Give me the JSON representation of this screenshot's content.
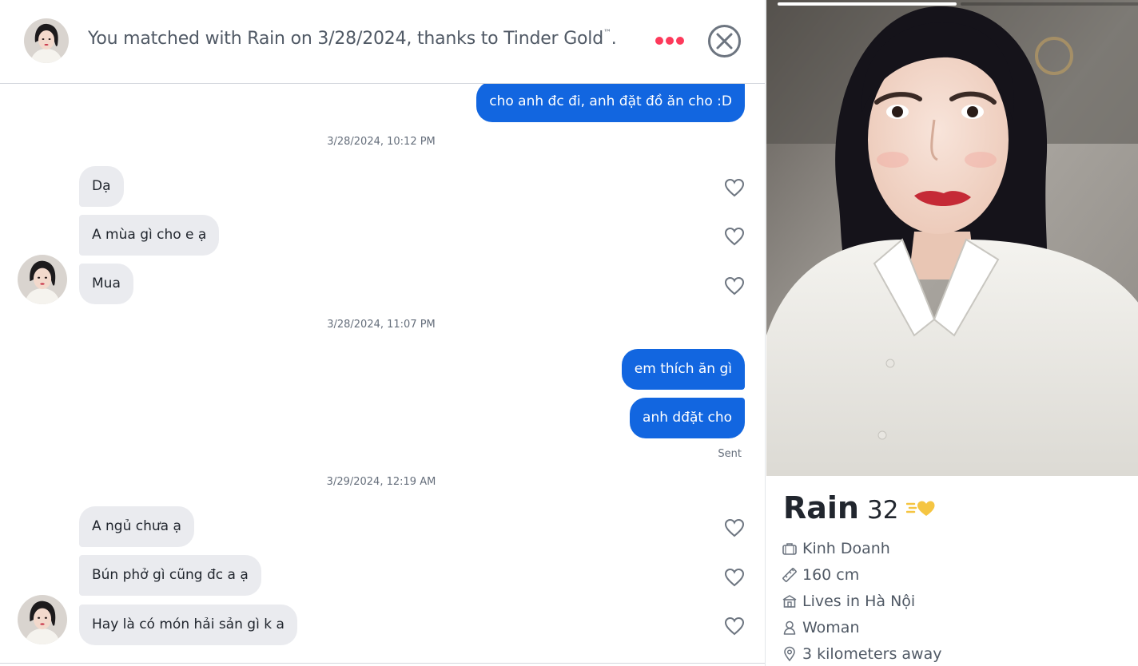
{
  "header": {
    "match_text": "You matched with Rain on 3/28/2024, thanks to Tinder Gold",
    "trademark": "™",
    "period": ".",
    "more_icon": "more-dots-icon",
    "close_icon": "close-circle-icon"
  },
  "messages": {
    "m1": "cho anh đc đi, anh đặt đồ ăn cho :D",
    "ts1": "3/28/2024, 10:12 PM",
    "m2": "Dạ",
    "m3": "A mùa gì cho e ạ",
    "m4": "Mua",
    "ts2": "3/28/2024, 11:07 PM",
    "m5": "em thích ăn gì",
    "m6": "anh dđặt cho",
    "sent_status": "Sent",
    "ts3": "3/29/2024, 12:19 AM",
    "m7": "A ngủ chưa ạ",
    "m8": "Bún phở gì cũng đc a ạ",
    "m9": "Hay là có món hải sản gì k a"
  },
  "profile": {
    "name": "Rain",
    "age": "32",
    "photo_count": 2,
    "photo_index": 1,
    "info": {
      "job": "Kinh Doanh",
      "height": "160 cm",
      "location": "Lives in Hà Nội",
      "gender": "Woman",
      "distance": "3 kilometers away"
    }
  },
  "colors": {
    "sent_bubble": "#1266e0",
    "received_bubble": "#eaebef",
    "accent": "#fd3a5b",
    "gold": "#f5c542"
  }
}
